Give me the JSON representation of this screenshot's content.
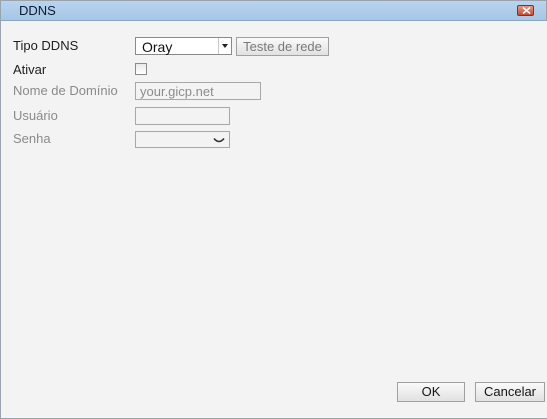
{
  "window": {
    "title": "DDNS"
  },
  "form": {
    "ddns_type": {
      "label": "Tipo DDNS",
      "selected": "Oray"
    },
    "test_button_label": "Teste de rede",
    "enable": {
      "label": "Ativar",
      "checked": false
    },
    "domain": {
      "label": "Nome de Domínio",
      "value": "your.gicp.net"
    },
    "user": {
      "label": "Usuário",
      "value": ""
    },
    "password": {
      "label": "Senha",
      "value": ""
    }
  },
  "footer": {
    "ok_label": "OK",
    "cancel_label": "Cancelar"
  },
  "colors": {
    "titlebar": "#b0cdea",
    "close_button": "#c84b32",
    "background": "#f3f3f3",
    "disabled_text": "#8a8a8a"
  },
  "icons": {
    "close": "close-icon",
    "dropdown_arrow": "dropdown-arrow-icon",
    "chevron_down": "chevron-down-icon"
  }
}
